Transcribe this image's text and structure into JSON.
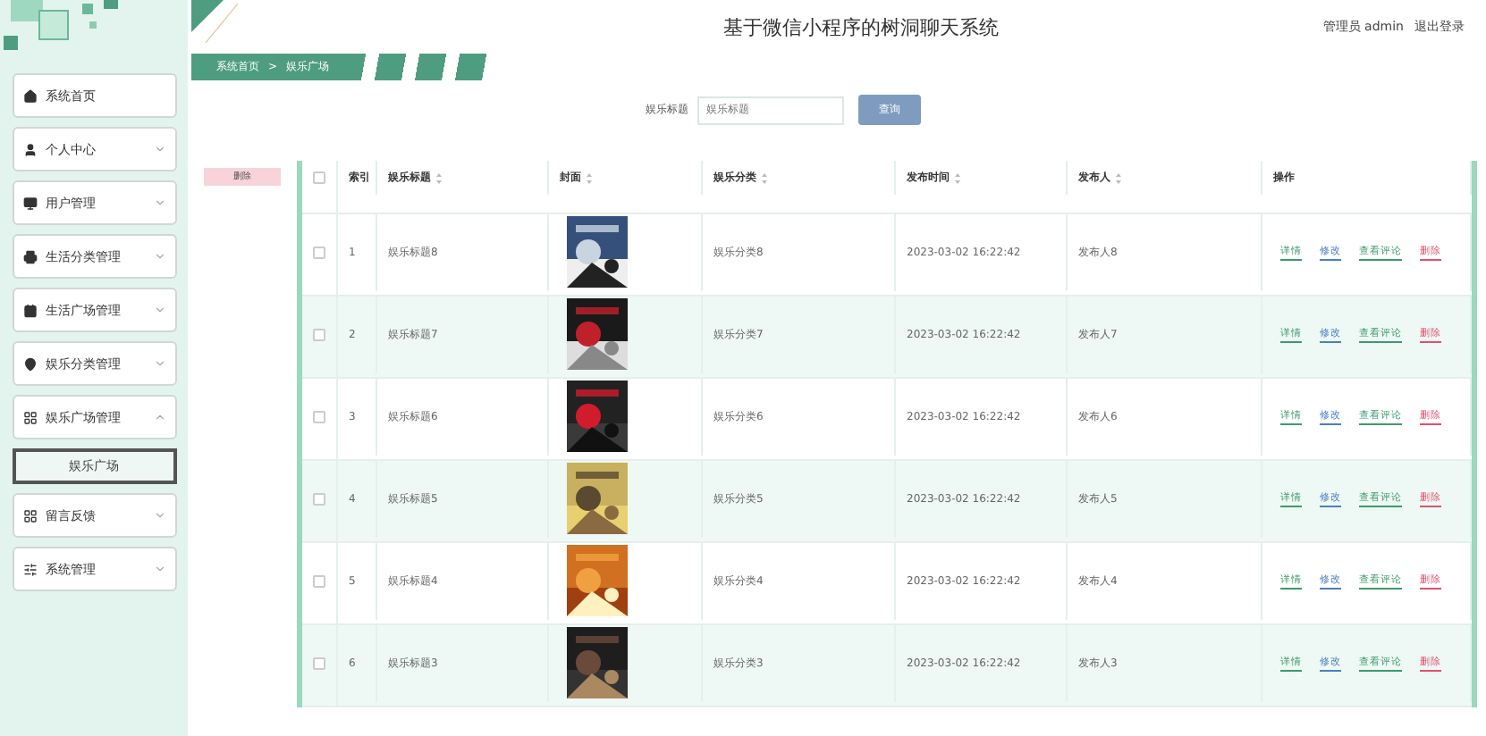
{
  "header": {
    "title": "基于微信小程序的树洞聊天系统",
    "user": "管理员 admin",
    "logout": "退出登录"
  },
  "sidebar": {
    "items": [
      {
        "label": "系统首页"
      },
      {
        "label": "个人中心",
        "expanded": false
      },
      {
        "label": "用户管理",
        "expanded": false
      },
      {
        "label": "生活分类管理",
        "expanded": false
      },
      {
        "label": "生活广场管理",
        "expanded": false
      },
      {
        "label": "娱乐分类管理",
        "expanded": false
      },
      {
        "label": "娱乐广场管理",
        "expanded": true,
        "children": [
          {
            "label": "娱乐广场",
            "selected": true
          }
        ]
      },
      {
        "label": "留言反馈",
        "expanded": false
      },
      {
        "label": "系统管理",
        "expanded": false
      }
    ]
  },
  "breadcrumb": {
    "items": [
      "系统首页",
      "娱乐广场"
    ],
    "separator": ">"
  },
  "search": {
    "label": "娱乐标题",
    "placeholder": "娱乐标题",
    "button": "查询"
  },
  "delete_button": "删除",
  "table": {
    "all_selected": false,
    "columns": [
      {
        "label": "索引",
        "sortable": false
      },
      {
        "label": "娱乐标题",
        "sortable": true
      },
      {
        "label": "封面",
        "sortable": true
      },
      {
        "label": "娱乐分类",
        "sortable": true
      },
      {
        "label": "发布时间",
        "sortable": true
      },
      {
        "label": "发布人",
        "sortable": true
      },
      {
        "label": "操作",
        "sortable": false
      }
    ],
    "rows": [
      {
        "selected": false,
        "index": "1",
        "title": "娱乐标题8",
        "category": "娱乐分类8",
        "time": "2023-03-02 16:22:42",
        "author": "发布人8",
        "actions": [
          {
            "label": "详情",
            "color": "#3c9a6e"
          },
          {
            "label": "修改",
            "color": "#4a7fc1"
          },
          {
            "label": "查看评论",
            "color": "#3c9a6e"
          },
          {
            "label": "删除",
            "color": "#e0506e"
          }
        ]
      },
      {
        "selected": false,
        "index": "2",
        "title": "娱乐标题7",
        "category": "娱乐分类7",
        "time": "2023-03-02 16:22:42",
        "author": "发布人7",
        "actions": [
          {
            "label": "详情",
            "color": "#3c9a6e"
          },
          {
            "label": "修改",
            "color": "#4a7fc1"
          },
          {
            "label": "查看评论",
            "color": "#3c9a6e"
          },
          {
            "label": "删除",
            "color": "#e0506e"
          }
        ]
      },
      {
        "selected": false,
        "index": "3",
        "title": "娱乐标题6",
        "category": "娱乐分类6",
        "time": "2023-03-02 16:22:42",
        "author": "发布人6",
        "actions": [
          {
            "label": "详情",
            "color": "#3c9a6e"
          },
          {
            "label": "修改",
            "color": "#4a7fc1"
          },
          {
            "label": "查看评论",
            "color": "#3c9a6e"
          },
          {
            "label": "删除",
            "color": "#e0506e"
          }
        ]
      },
      {
        "selected": false,
        "index": "4",
        "title": "娱乐标题5",
        "category": "娱乐分类5",
        "time": "2023-03-02 16:22:42",
        "author": "发布人5",
        "actions": [
          {
            "label": "详情",
            "color": "#3c9a6e"
          },
          {
            "label": "修改",
            "color": "#4a7fc1"
          },
          {
            "label": "查看评论",
            "color": "#3c9a6e"
          },
          {
            "label": "删除",
            "color": "#e0506e"
          }
        ]
      },
      {
        "selected": false,
        "index": "5",
        "title": "娱乐标题4",
        "category": "娱乐分类4",
        "time": "2023-03-02 16:22:42",
        "author": "发布人4",
        "actions": [
          {
            "label": "详情",
            "color": "#3c9a6e"
          },
          {
            "label": "修改",
            "color": "#4a7fc1"
          },
          {
            "label": "查看评论",
            "color": "#3c9a6e"
          },
          {
            "label": "删除",
            "color": "#e0506e"
          }
        ]
      },
      {
        "selected": false,
        "index": "6",
        "title": "娱乐标题3",
        "category": "娱乐分类3",
        "time": "2023-03-02 16:22:42",
        "author": "发布人3",
        "actions": [
          {
            "label": "详情",
            "color": "#3c9a6e"
          },
          {
            "label": "修改",
            "color": "#4a7fc1"
          },
          {
            "label": "查看评论",
            "color": "#3c9a6e"
          },
          {
            "label": "删除",
            "color": "#e0506e"
          }
        ]
      }
    ]
  }
}
